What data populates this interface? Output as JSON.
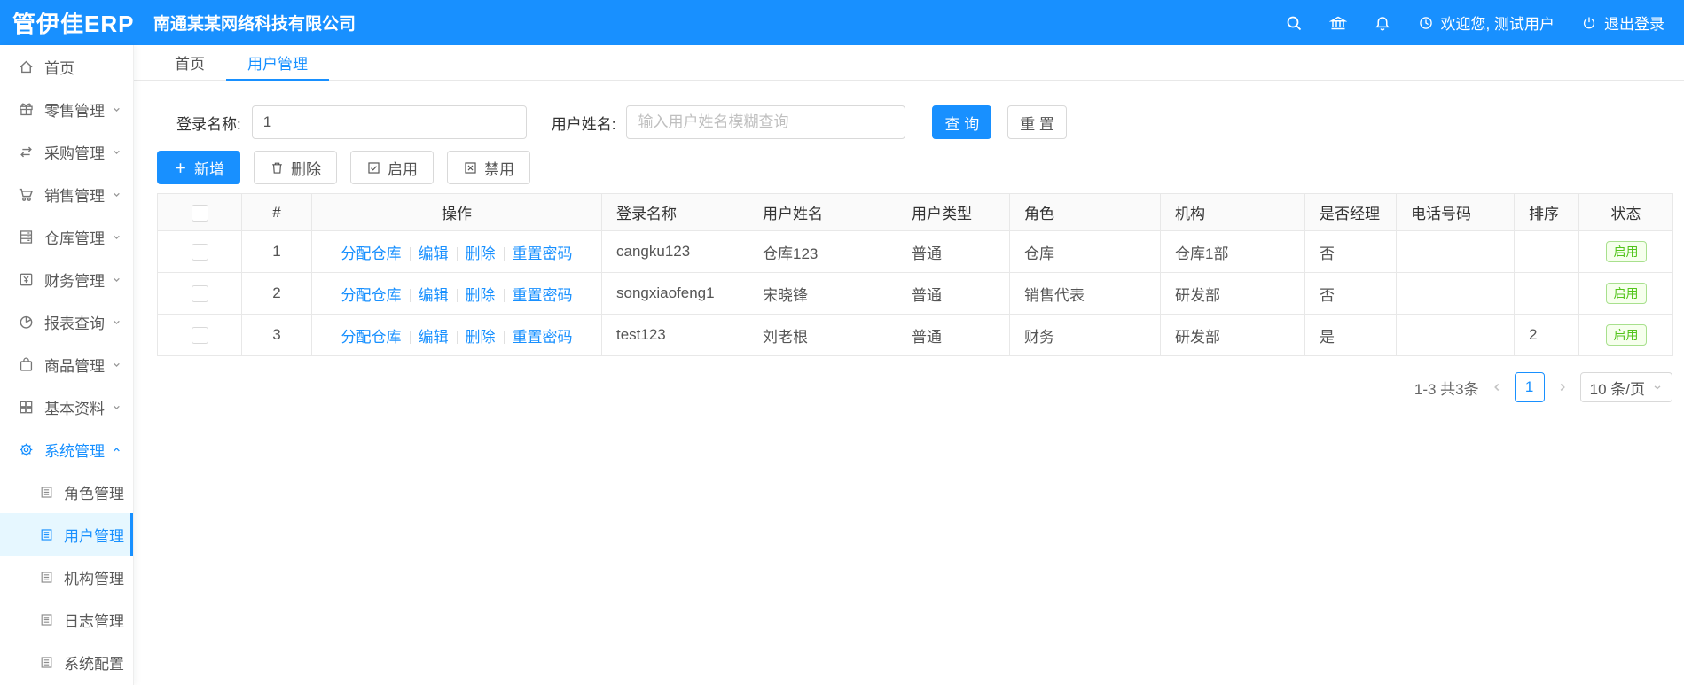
{
  "header": {
    "logo": "管伊佳ERP",
    "company": "南通某某网络科技有限公司",
    "welcome": "欢迎您, 测试用户",
    "logout": "退出登录"
  },
  "sidebar": {
    "items": [
      {
        "label": "首页",
        "icon": "home-icon"
      },
      {
        "label": "零售管理",
        "icon": "gift-icon"
      },
      {
        "label": "采购管理",
        "icon": "swap-icon"
      },
      {
        "label": "销售管理",
        "icon": "cart-icon"
      },
      {
        "label": "仓库管理",
        "icon": "warehouse-icon"
      },
      {
        "label": "财务管理",
        "icon": "finance-icon"
      },
      {
        "label": "报表查询",
        "icon": "piechart-icon"
      },
      {
        "label": "商品管理",
        "icon": "bag-icon"
      },
      {
        "label": "基本资料",
        "icon": "grid-icon"
      },
      {
        "label": "系统管理",
        "icon": "gear-icon",
        "expanded": true
      }
    ],
    "subitems": [
      {
        "label": "角色管理"
      },
      {
        "label": "用户管理",
        "active": true
      },
      {
        "label": "机构管理"
      },
      {
        "label": "日志管理"
      },
      {
        "label": "系统配置"
      }
    ]
  },
  "tabs": [
    {
      "label": "首页"
    },
    {
      "label": "用户管理",
      "active": true
    }
  ],
  "search": {
    "login_label": "登录名称:",
    "login_value": "1",
    "name_label": "用户姓名:",
    "name_placeholder": "输入用户姓名模糊查询",
    "query": "查 询",
    "reset": "重 置"
  },
  "toolbar": {
    "add": "新增",
    "delete": "删除",
    "enable": "启用",
    "disable": "禁用"
  },
  "table": {
    "columns": [
      "#",
      "操作",
      "登录名称",
      "用户姓名",
      "用户类型",
      "角色",
      "机构",
      "是否经理",
      "电话号码",
      "排序",
      "状态"
    ],
    "actions": [
      "分配仓库",
      "编辑",
      "删除",
      "重置密码"
    ],
    "rows": [
      {
        "index": "1",
        "login": "cangku123",
        "name": "仓库123",
        "type": "普通",
        "role": "仓库",
        "org": "仓库1部",
        "manager": "否",
        "phone": "",
        "sort": "",
        "status": "启用"
      },
      {
        "index": "2",
        "login": "songxiaofeng1",
        "name": "宋晓锋",
        "type": "普通",
        "role": "销售代表",
        "org": "研发部",
        "manager": "否",
        "phone": "",
        "sort": "",
        "status": "启用"
      },
      {
        "index": "3",
        "login": "test123",
        "name": "刘老根",
        "type": "普通",
        "role": "财务",
        "org": "研发部",
        "manager": "是",
        "phone": "",
        "sort": "2",
        "status": "启用"
      }
    ]
  },
  "pagination": {
    "total": "1-3 共3条",
    "page": "1",
    "size": "10 条/页"
  },
  "colors": {
    "accent": "#1890ff",
    "status_green": "#52c41a",
    "status_green_bg": "#f6ffed"
  }
}
